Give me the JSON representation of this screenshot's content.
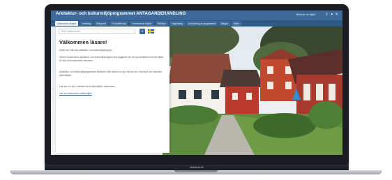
{
  "app": {
    "title": "Arkitektur- och kulturmiljöprogrammet ANTAGANDEHANDLING",
    "user_text": "Behöver du hjälp?",
    "header_icons": [
      "share-icon",
      "twitter-icon",
      "edit-icon"
    ]
  },
  "tabs": [
    "Välkommen läsare!",
    "Inledning",
    "Bakgrund",
    "Förutsättningar",
    "Kommunens miljöer",
    "Riktlinjer",
    "Vägledning",
    "Användning av programmet",
    "Bilagor",
    "Källor"
  ],
  "panel": {
    "search_placeholder": "Sök i dokumentet",
    "heading": "Välkommen läsare!",
    "paragraphs": [
      "Syftet och mål med arkitektur- och kulturmiljöprogram",
      "Genom kommunens arkitektur- och kulturmiljöprogram ska bygglovet och de nya bostäderna bli det bästa för alla och kommunens intressen.",
      "Arkitektur- och kulturmiljöprogrammet beskriver våra värden och ger råd om hur vi bevarar och utvecklar kulturmiljöer.",
      "Läs mer om hur vi arbetar med kulturmiljöer i kommunen."
    ],
    "link_text": "Läs om kommunens kulturmiljöer"
  },
  "laptop": {
    "brand": "MacBook Air"
  }
}
